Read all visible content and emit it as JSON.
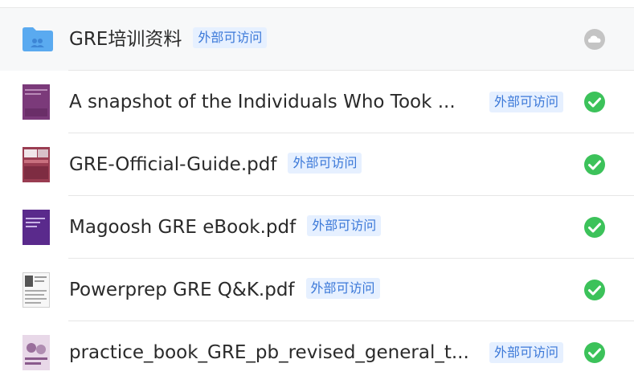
{
  "tag_text": "外部可访问",
  "colors": {
    "accent": "#3b78d8",
    "tag_bg": "#e6f0ff",
    "ok": "#3cc25a",
    "cloud": "#bbbbbb",
    "folder": "#5aaaf0"
  },
  "files": [
    {
      "name": "GRE培训资料",
      "type": "folder",
      "icon": "folder-icon",
      "status": "cloud-icon"
    },
    {
      "name": "A snapshot of the Individuals Who Took ...",
      "type": "pdf",
      "icon": "pdf-thumbnail",
      "status": "synced-check-icon"
    },
    {
      "name": "GRE-Official-Guide.pdf",
      "type": "pdf",
      "icon": "pdf-thumbnail",
      "status": "synced-check-icon"
    },
    {
      "name": "Magoosh GRE eBook.pdf",
      "type": "pdf",
      "icon": "pdf-thumbnail",
      "status": "synced-check-icon"
    },
    {
      "name": "Powerprep GRE Q&K.pdf",
      "type": "pdf",
      "icon": "pdf-thumbnail",
      "status": "synced-check-icon"
    },
    {
      "name": "practice_book_GRE_pb_revised_general_t...",
      "type": "pdf",
      "icon": "pdf-thumbnail",
      "status": "synced-check-icon"
    }
  ]
}
